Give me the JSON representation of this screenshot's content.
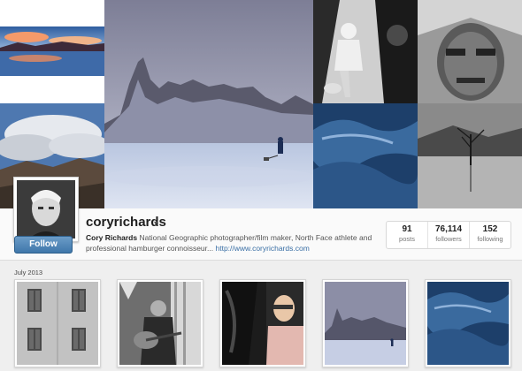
{
  "profile": {
    "username": "coryrichards",
    "full_name": "Cory Richards",
    "bio": "National Geographic photographer/film maker, North Face athlete and professional hamburger connoisseur...",
    "website": "http://www.coryrichards.com",
    "follow_label": "Follow",
    "caret": "▾"
  },
  "stats": [
    {
      "value": "91",
      "label": "posts"
    },
    {
      "value": "76,114",
      "label": "followers"
    },
    {
      "value": "152",
      "label": "following"
    }
  ],
  "feed": {
    "section_label": "July 2013"
  },
  "colors": {
    "follow_button": "#4a7fb0",
    "link": "#3a6fa5"
  }
}
